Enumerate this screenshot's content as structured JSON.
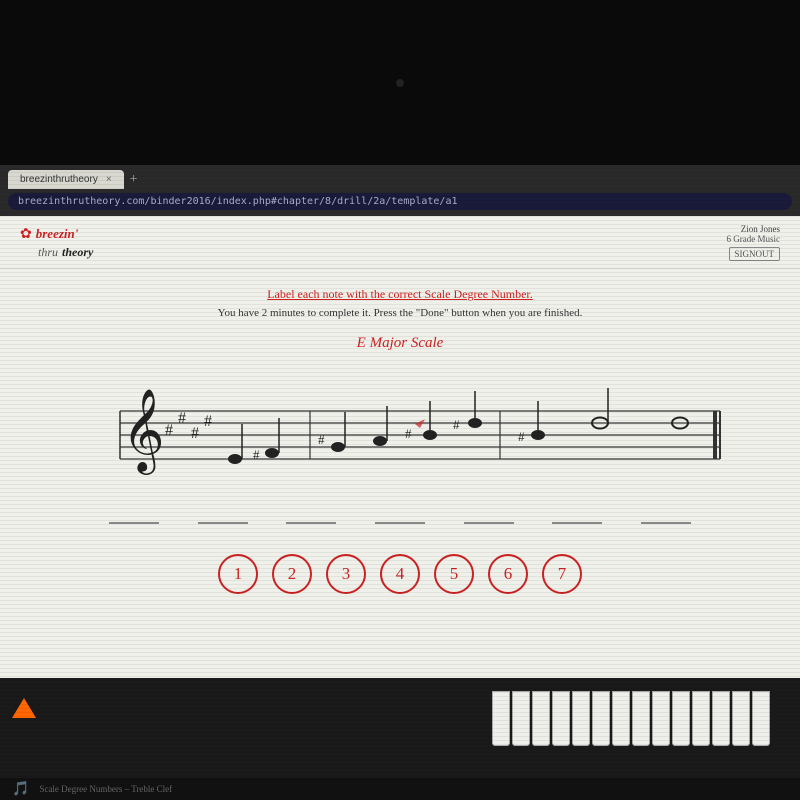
{
  "browser": {
    "tab_label": "×",
    "tab_plus": "+",
    "address": "breezinthrutheory.com/binder2016/index.php#chapter/8/drill/2a/template/a1"
  },
  "header": {
    "logo_breezin": "breezin'",
    "logo_thru": "thru",
    "logo_theory": "theory",
    "user_name": "Zion Jones",
    "user_grade": "6 Grade Music",
    "signout_label": "SIGNOUT"
  },
  "instructions": {
    "title": "Label each note with the correct Scale Degree Number.",
    "subtitle": "You have 2 minutes to complete it. Press the \"Done\" button when you are finished."
  },
  "scale": {
    "title": "E Major Scale"
  },
  "number_buttons": [
    "1",
    "2",
    "3",
    "4",
    "5",
    "6",
    "7"
  ],
  "footer": {
    "page_info": "Scale Degree Numbers – Treble Clef"
  },
  "colors": {
    "red": "#cc2222",
    "dark": "#222",
    "bg": "#f5f5f0"
  }
}
